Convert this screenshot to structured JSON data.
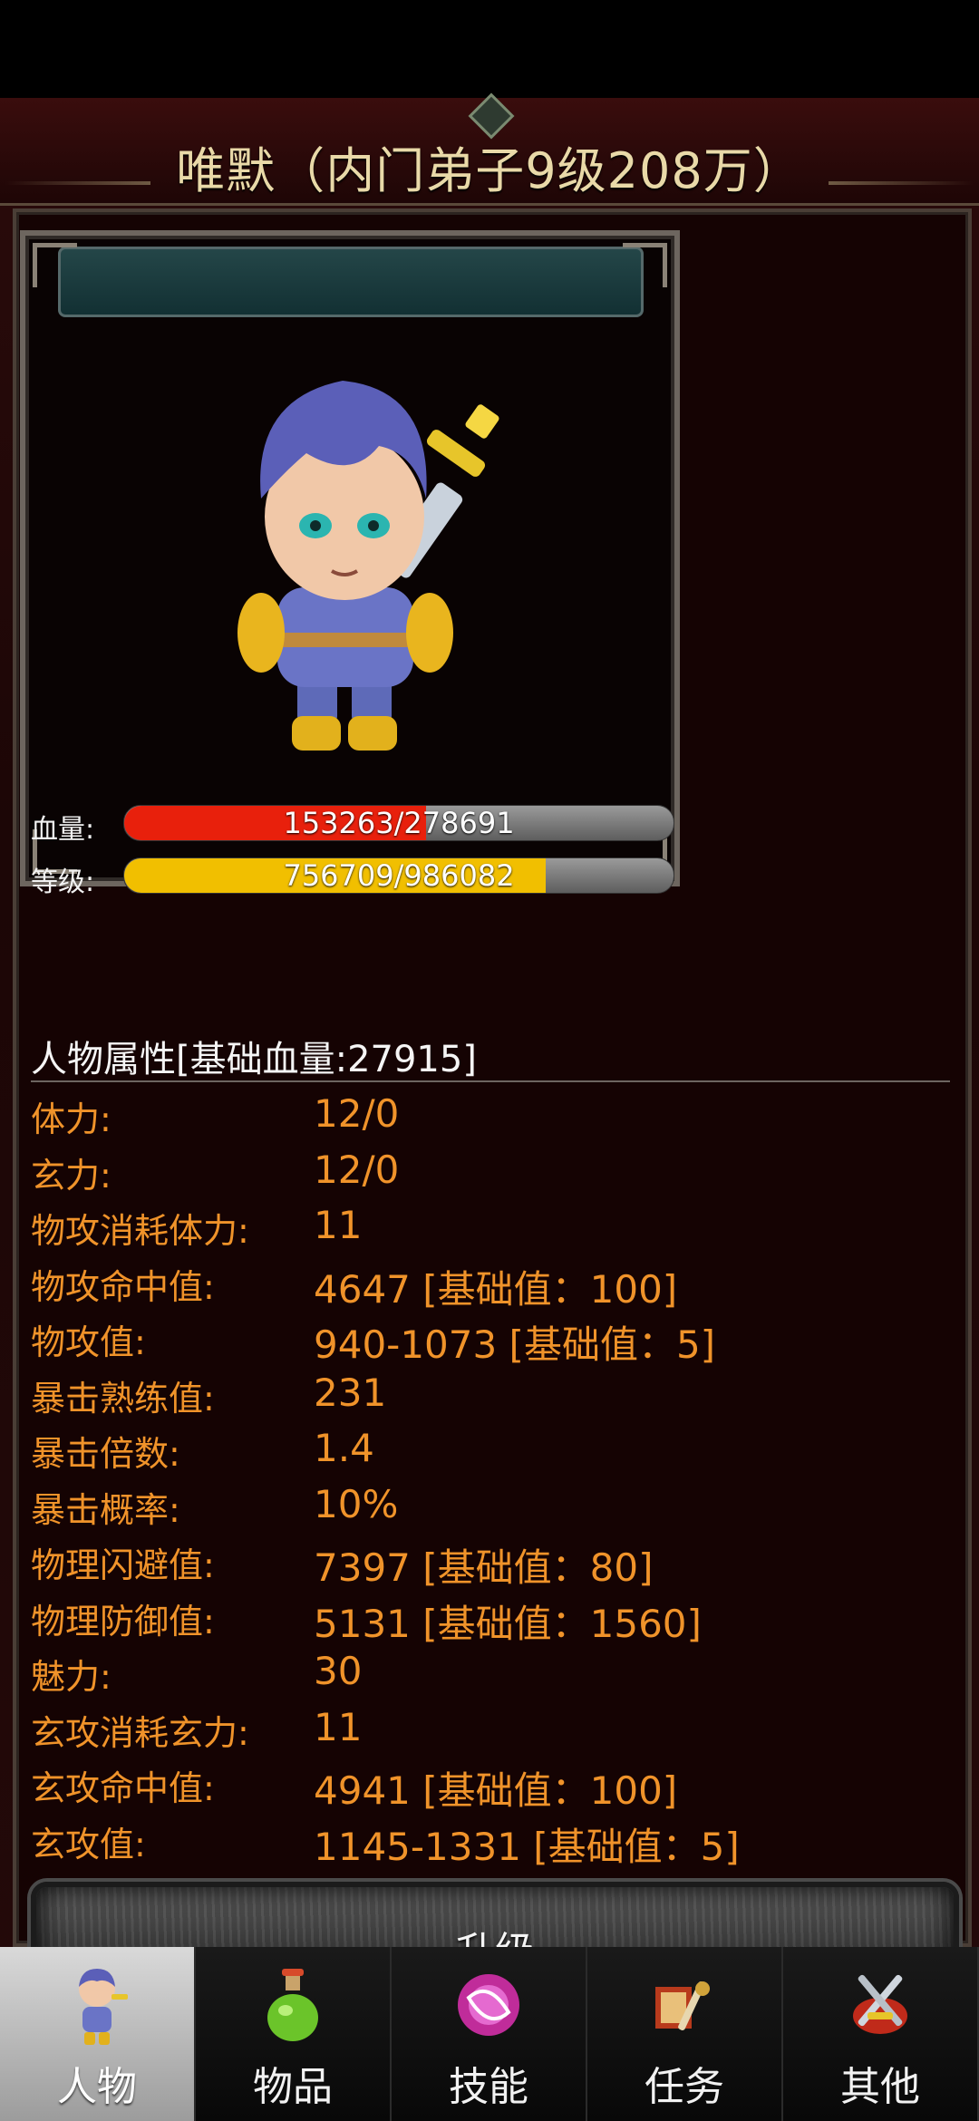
{
  "header": {
    "title": "唯默（内门弟子9级208万）"
  },
  "character": {
    "hp": {
      "label": "血量:",
      "text": "153263/278691",
      "fraction": 0.55,
      "color": "#e8200c"
    },
    "level": {
      "label": "等级:",
      "text": "756709/986082",
      "fraction": 0.7674,
      "color": "#f1bf00"
    }
  },
  "attributes": {
    "header": "人物属性[基础血量:27915]",
    "rows": [
      {
        "label": "体力:",
        "value": "12/0"
      },
      {
        "label": "玄力:",
        "value": "12/0"
      },
      {
        "label": "物攻消耗体力:",
        "value": "11"
      },
      {
        "label": "物攻命中值:",
        "value": "4647 [基础值：100]"
      },
      {
        "label": "物攻值:",
        "value": "940-1073 [基础值：5]"
      },
      {
        "label": "暴击熟练值:",
        "value": "231"
      },
      {
        "label": "暴击倍数:",
        "value": "1.4"
      },
      {
        "label": "暴击概率:",
        "value": "10%"
      },
      {
        "label": "物理闪避值:",
        "value": "7397 [基础值：80]"
      },
      {
        "label": "物理防御值:",
        "value": "5131 [基础值：1560]"
      },
      {
        "label": "魅力:",
        "value": "30"
      },
      {
        "label": "玄攻消耗玄力:",
        "value": "11"
      },
      {
        "label": "玄攻命中值:",
        "value": "4941 [基础值：100]"
      },
      {
        "label": "玄攻值:",
        "value": "1145-1331 [基础值：5]"
      }
    ]
  },
  "upgrade": {
    "label": "升级"
  },
  "nav": {
    "items": [
      {
        "label": "人物",
        "icon": "character-icon",
        "active": true
      },
      {
        "label": "物品",
        "icon": "potion-icon",
        "active": false
      },
      {
        "label": "技能",
        "icon": "skill-orb-icon",
        "active": false
      },
      {
        "label": "任务",
        "icon": "quest-scroll-icon",
        "active": false
      },
      {
        "label": "其他",
        "icon": "crossed-swords-icon",
        "active": false
      }
    ]
  },
  "colors": {
    "accent_text": "#f0932a",
    "title_text": "#e9d9a8"
  }
}
